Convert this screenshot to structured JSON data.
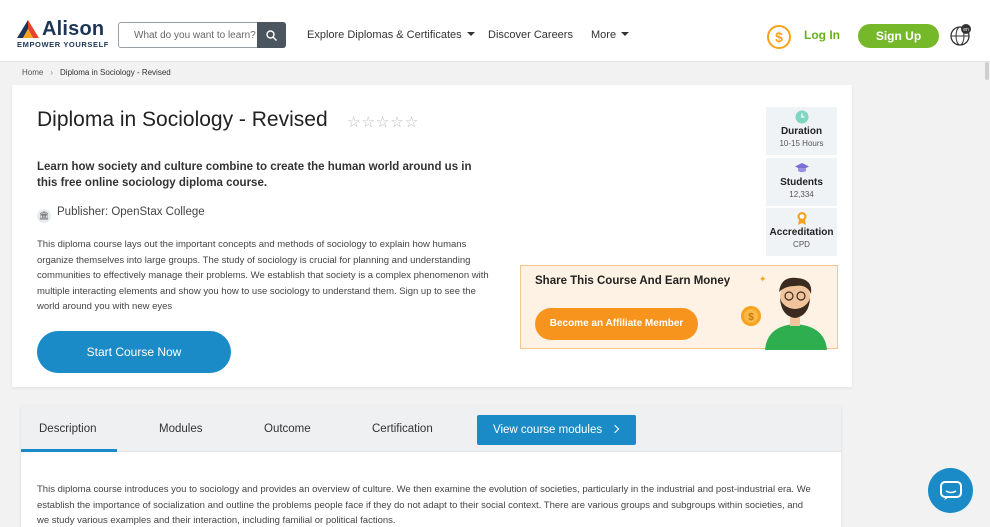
{
  "header": {
    "logo_name": "Alison",
    "logo_tagline": "EMPOWER YOURSELF",
    "search_placeholder": "What do you want to learn?",
    "nav": [
      "Explore Diplomas & Certificates",
      "Discover Careers",
      "More"
    ],
    "coin_symbol": "$",
    "login_label": "Log In",
    "signup_label": "Sign Up",
    "language_badge": "en"
  },
  "breadcrumb": {
    "home": "Home",
    "current": "Diploma in Sociology - Revised"
  },
  "course": {
    "title": "Diploma in Sociology - Revised",
    "stars": "☆☆☆☆☆",
    "rating": 0,
    "lead": "Learn how society and culture combine to create the human world around us in this free online sociology diploma course.",
    "publisher": "Publisher: OpenStax College",
    "description": "This diploma course lays out the important concepts and methods of sociology to explain how humans organize themselves into large groups. The study of sociology is crucial for planning and understanding communities to effectively manage their problems. We establish that society is a complex phenomenon with multiple interacting elements and show you how to use sociology to understand them. Sign up to see the world around you with new eyes",
    "start_label": "Start Course Now"
  },
  "stats": [
    {
      "label": "Duration",
      "value": "10-15 Hours",
      "icon": "clock-icon"
    },
    {
      "label": "Students",
      "value": "12,334",
      "icon": "graduation-cap-icon"
    },
    {
      "label": "Accreditation",
      "value": "CPD",
      "icon": "award-icon"
    }
  ],
  "affiliate": {
    "title": "Share This Course And Earn Money",
    "button_label": "Become an Affiliate Member",
    "coin_symbol": "$"
  },
  "tabs": {
    "items": [
      "Description",
      "Modules",
      "Outcome",
      "Certification"
    ],
    "active": "Description",
    "view_modules_label": "View course modules",
    "body": "This diploma course introduces you to sociology and provides an overview of culture. We then examine the evolution of societies, particularly in the industrial and post-industrial era. We establish the importance of socialization and outline the problems people face if they do not adapt to their social context. There are various groups and subgroups within societies, and we study various examples and their interaction, including familial or political factions."
  },
  "colors": {
    "brand_green": "#75b829",
    "primary_blue": "#1a8bc7",
    "accent_orange": "#f7941d"
  }
}
